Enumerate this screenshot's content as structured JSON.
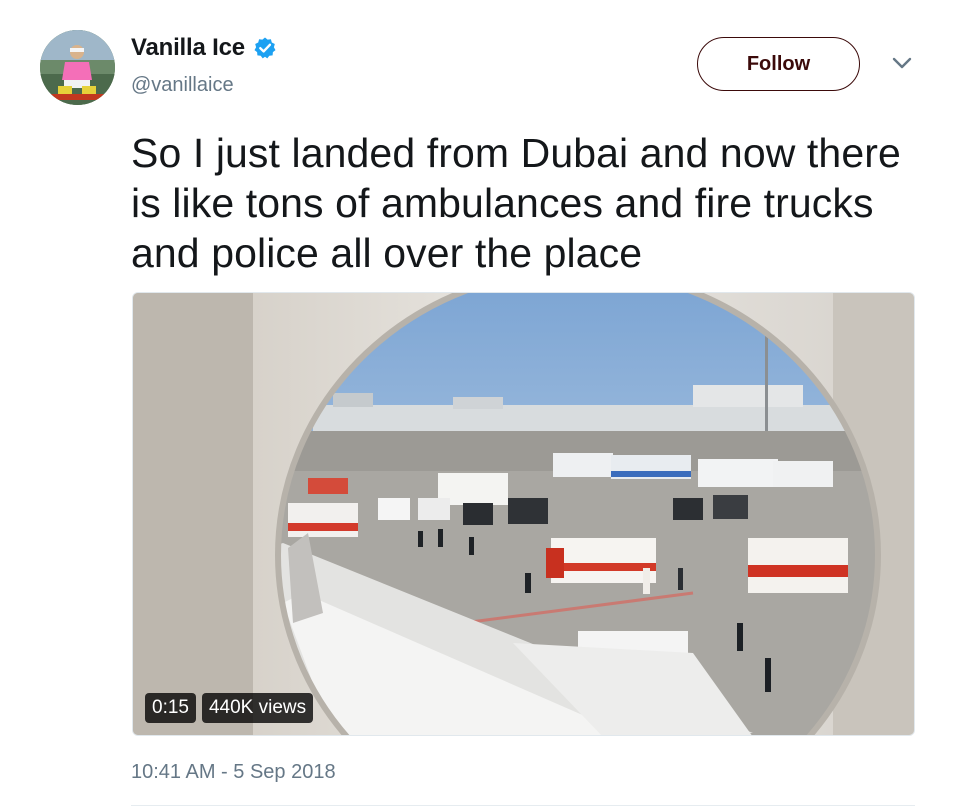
{
  "author": {
    "display_name": "Vanilla Ice",
    "handle": "@vanillaice",
    "verified": true
  },
  "follow_button": {
    "label": "Follow"
  },
  "tweet": {
    "text": "So I just landed from Dubai and now there is like tons of ambulances and fire trucks and police all over the place",
    "timestamp": "10:41 AM - 5 Sep 2018"
  },
  "video": {
    "duration": "0:15",
    "views": "440K views"
  },
  "icons": {
    "verified": "verified-badge-icon",
    "menu": "chevron-down-icon"
  },
  "colors": {
    "verified_blue": "#1da1f2",
    "follow_border": "#3b0a0a",
    "secondary_text": "#657786"
  }
}
